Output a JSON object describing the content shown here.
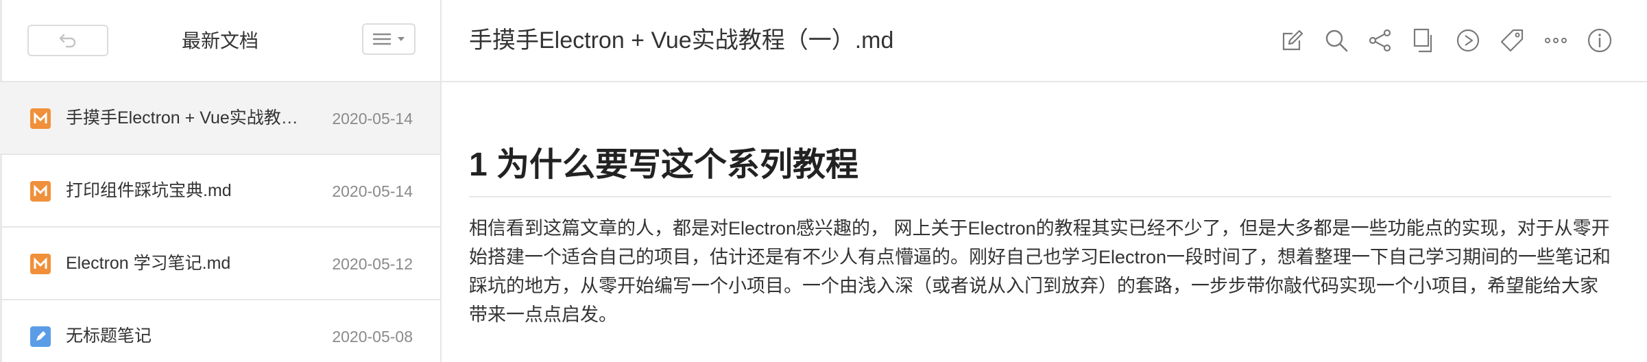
{
  "sidebar": {
    "title": "最新文档",
    "back_icon": "undo-arrow-icon",
    "menu_icon": "list-menu-icon",
    "items": [
      {
        "title": "手摸手Electron + Vue实战教程（一）.md",
        "date": "2020-05-14",
        "icon": "markdown-icon",
        "active": true
      },
      {
        "title": "打印组件踩坑宝典.md",
        "date": "2020-05-14",
        "icon": "markdown-icon",
        "active": false
      },
      {
        "title": "Electron 学习笔记.md",
        "date": "2020-05-12",
        "icon": "markdown-icon",
        "active": false
      },
      {
        "title": "无标题笔记",
        "date": "2020-05-08",
        "icon": "note-icon",
        "active": false
      }
    ]
  },
  "main": {
    "title": "手摸手Electron + Vue实战教程（一）.md",
    "toolbar": [
      "edit-icon",
      "search-icon",
      "share-icon",
      "copy-icon",
      "play-icon",
      "tag-icon",
      "more-icon",
      "info-icon"
    ],
    "heading": "1 为什么要写这个系列教程",
    "paragraph": "相信看到这篇文章的人，都是对Electron感兴趣的， 网上关于Electron的教程其实已经不少了，但是大多都是一些功能点的实现，对于从零开始搭建一个适合自己的项目，估计还是有不少人有点懵逼的。刚好自己也学习Electron一段时间了，想着整理一下自己学习期间的一些笔记和踩坑的地方，从零开始编写一个小项目。一个由浅入深（或者说从入门到放弃）的套路，一步步带你敲代码实现一个小项目，希望能给大家带来一点点启发。"
  },
  "colors": {
    "markdown_icon": "#f0903a",
    "note_icon": "#5a9de6",
    "active_row": "#f3f3f3",
    "border": "#e6e6e6",
    "date_text": "#8a8a8a",
    "icon_stroke": "#7a7a7a"
  }
}
